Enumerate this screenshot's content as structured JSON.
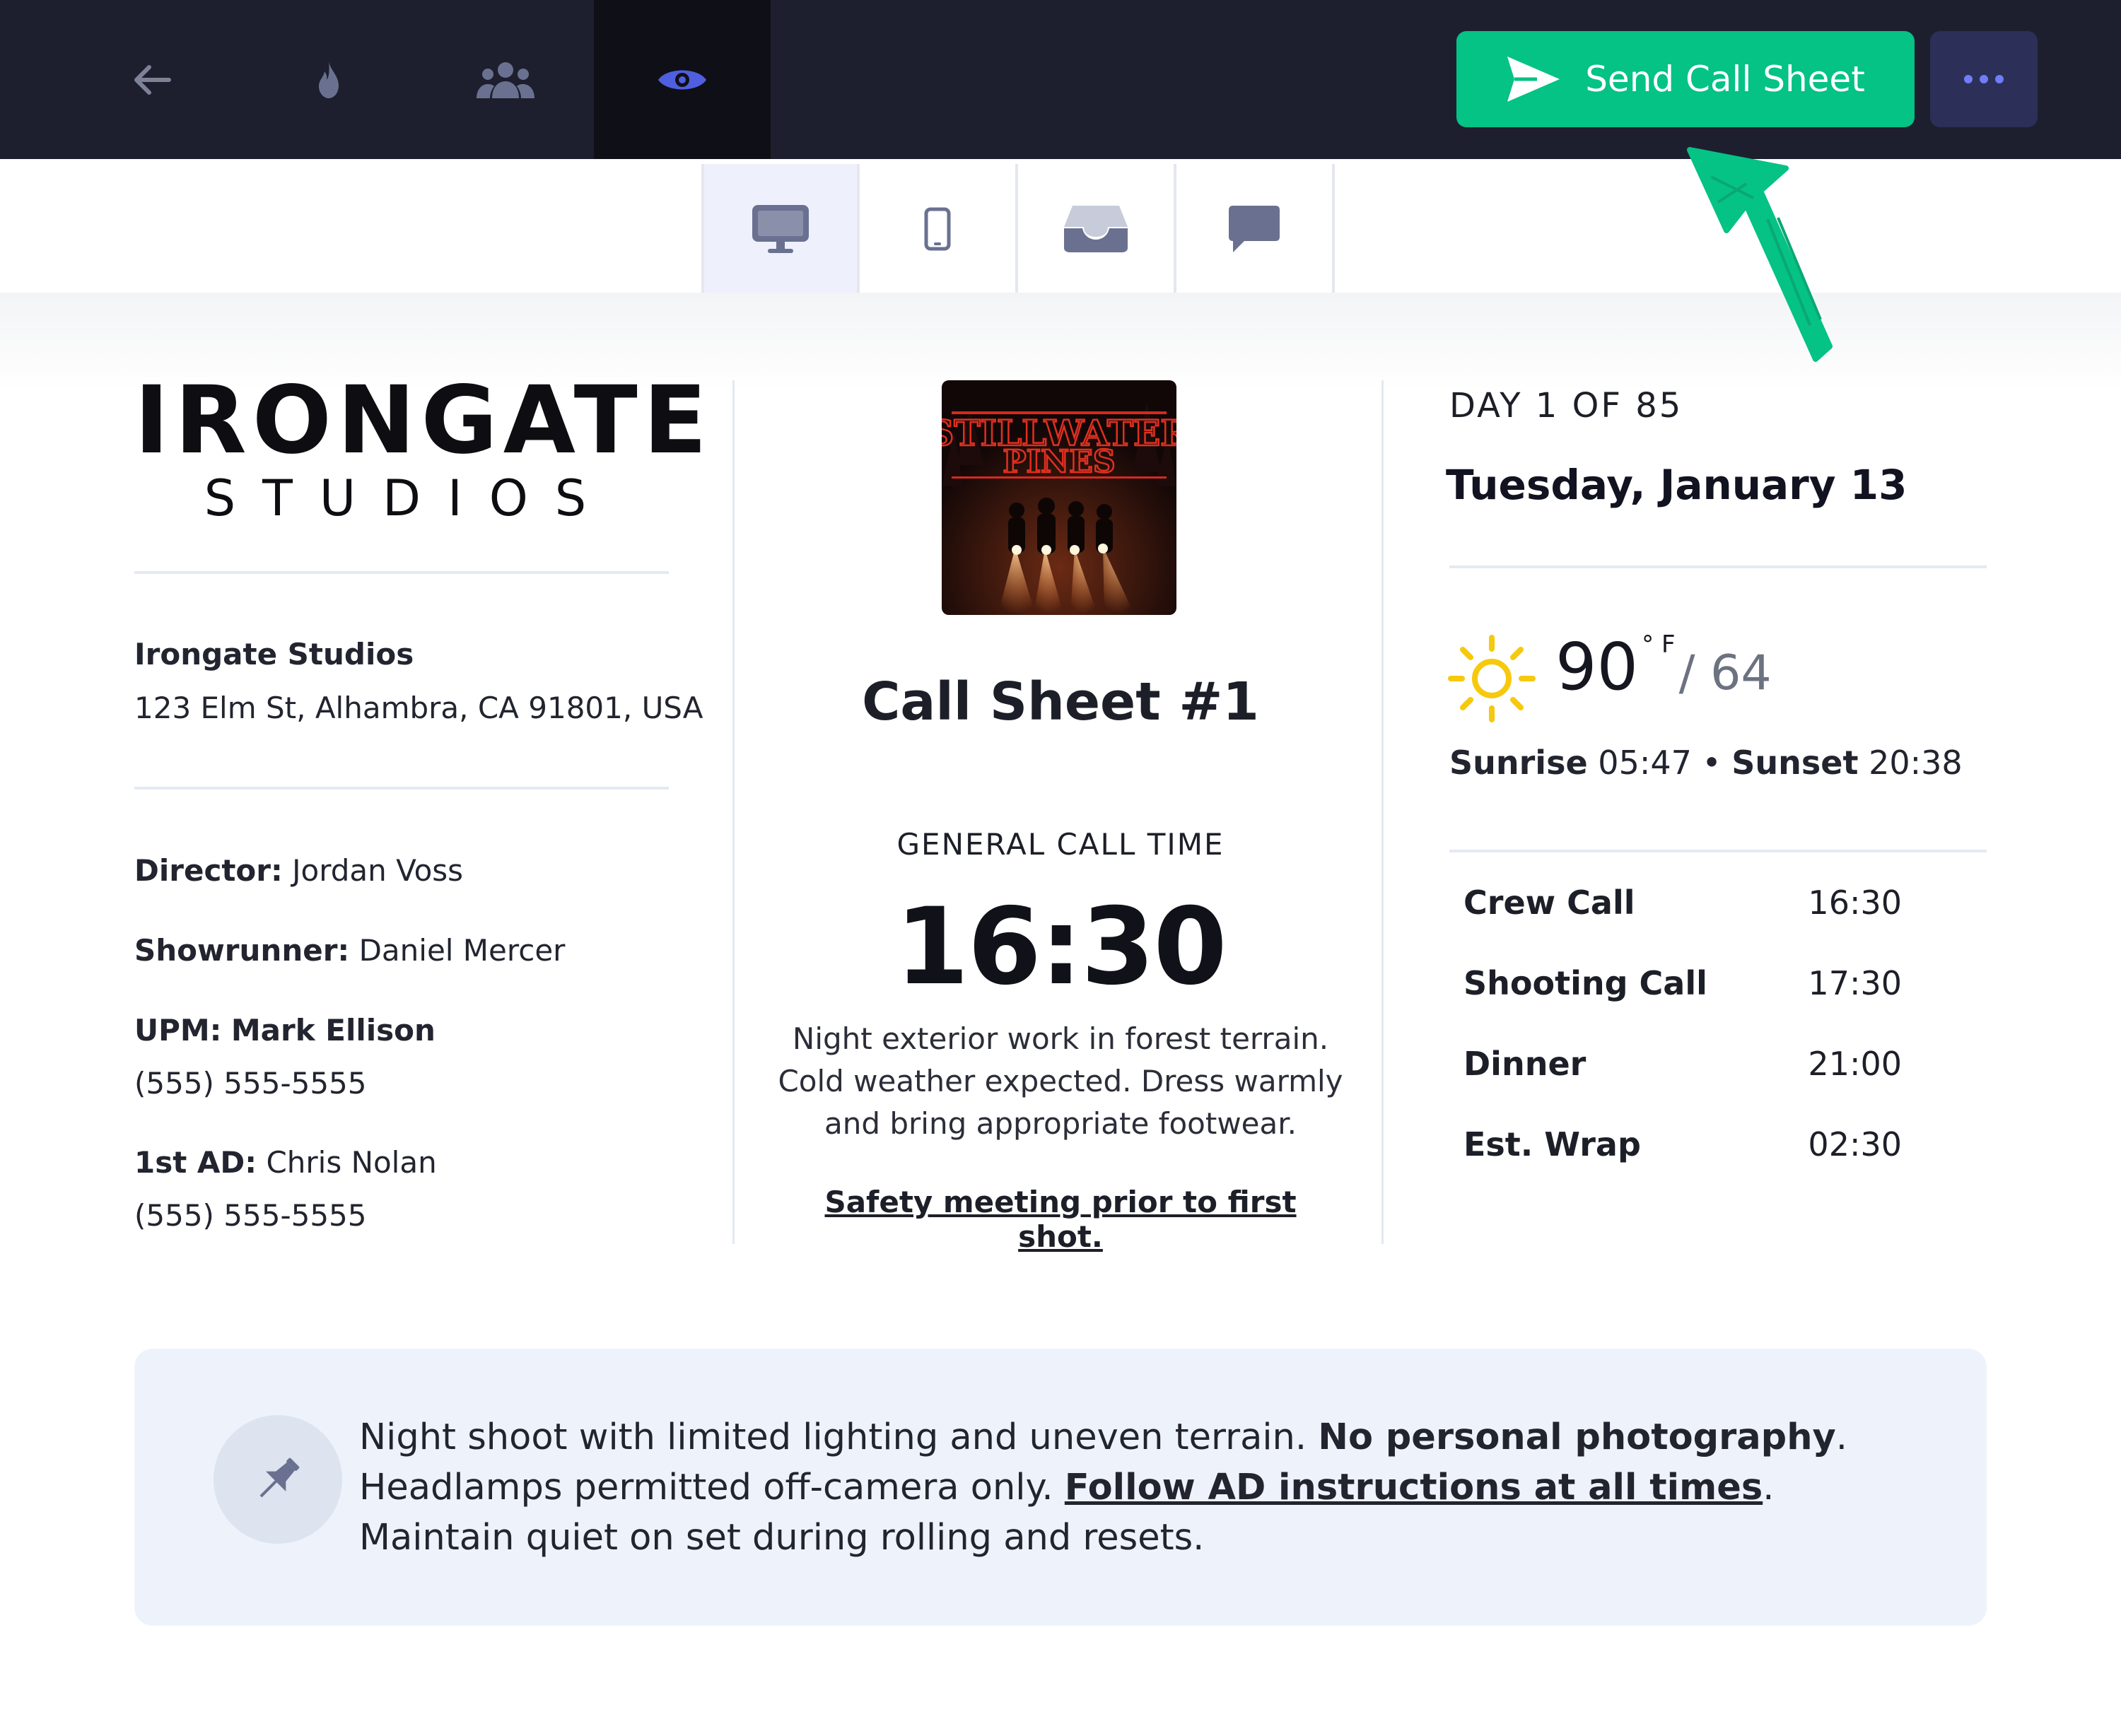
{
  "topbar": {
    "nav_icons": [
      "back-arrow-icon",
      "flame-icon",
      "team-icon",
      "eye-icon"
    ],
    "active_icon": "eye-icon",
    "send_label": "Send Call Sheet",
    "more_icon": "more-dots-icon"
  },
  "view_switcher": {
    "icons": [
      "desktop-icon",
      "mobile-icon",
      "inbox-icon",
      "chat-icon"
    ],
    "active": "desktop-icon"
  },
  "company": {
    "logo_main": "IRONGATE",
    "logo_sub": "STUDIOS",
    "name": "Irongate Studios",
    "address": "123 Elm St, Alhambra, CA 91801, USA"
  },
  "crew": {
    "director_label": "Director:",
    "director": "Jordan Voss",
    "showrunner_label": "Showrunner:",
    "showrunner": "Daniel Mercer",
    "upm_label": "UPM:",
    "upm": "Mark Ellison",
    "upm_phone": "(555) 555-5555",
    "ad_label": "1st AD:",
    "ad": "Chris Nolan",
    "ad_phone": "(555) 555-5555"
  },
  "poster": {
    "title_line1": "STILLWATER",
    "title_line2": "PINES"
  },
  "callsheet": {
    "title": "Call Sheet #1",
    "general_call_label": "GENERAL CALL TIME",
    "general_call_time": "16:30",
    "notes": "Night exterior work in forest terrain.\nCold weather expected. Dress warmly\nand bring appropriate footwear.",
    "safety": "Safety meeting prior to first shot."
  },
  "schedule_day": {
    "day_label": "DAY 1 OF 85",
    "date": "Tuesday, January 13"
  },
  "weather": {
    "icon": "sun-icon",
    "high": "90",
    "unit": "° F",
    "low": "/ 64",
    "sunrise_label": "Sunrise",
    "sunrise": "05:47",
    "separator": "•",
    "sunset_label": "Sunset",
    "sunset": "20:38"
  },
  "times": [
    {
      "label": "Crew Call",
      "time": "16:30"
    },
    {
      "label": "Shooting Call",
      "time": "17:30"
    },
    {
      "label": "Dinner",
      "time": "21:00"
    },
    {
      "label": "Est. Wrap",
      "time": "02:30"
    }
  ],
  "note": {
    "icon": "pin-icon",
    "part1": "Night shoot with limited lighting and uneven terrain. ",
    "bold": "No personal photography",
    "part2": ". Headlamps permitted off-camera only. ",
    "underline": "Follow AD instructions at all times",
    "part3": ". Maintain quiet on set during rolling and resets."
  },
  "colors": {
    "topbar_bg": "#1e1f2e",
    "accent_green": "#05c285",
    "more_button_bg": "#2c3058",
    "active_eye": "#4f5fe0",
    "note_bg": "#eef3fb",
    "sun": "#f6c90e"
  }
}
